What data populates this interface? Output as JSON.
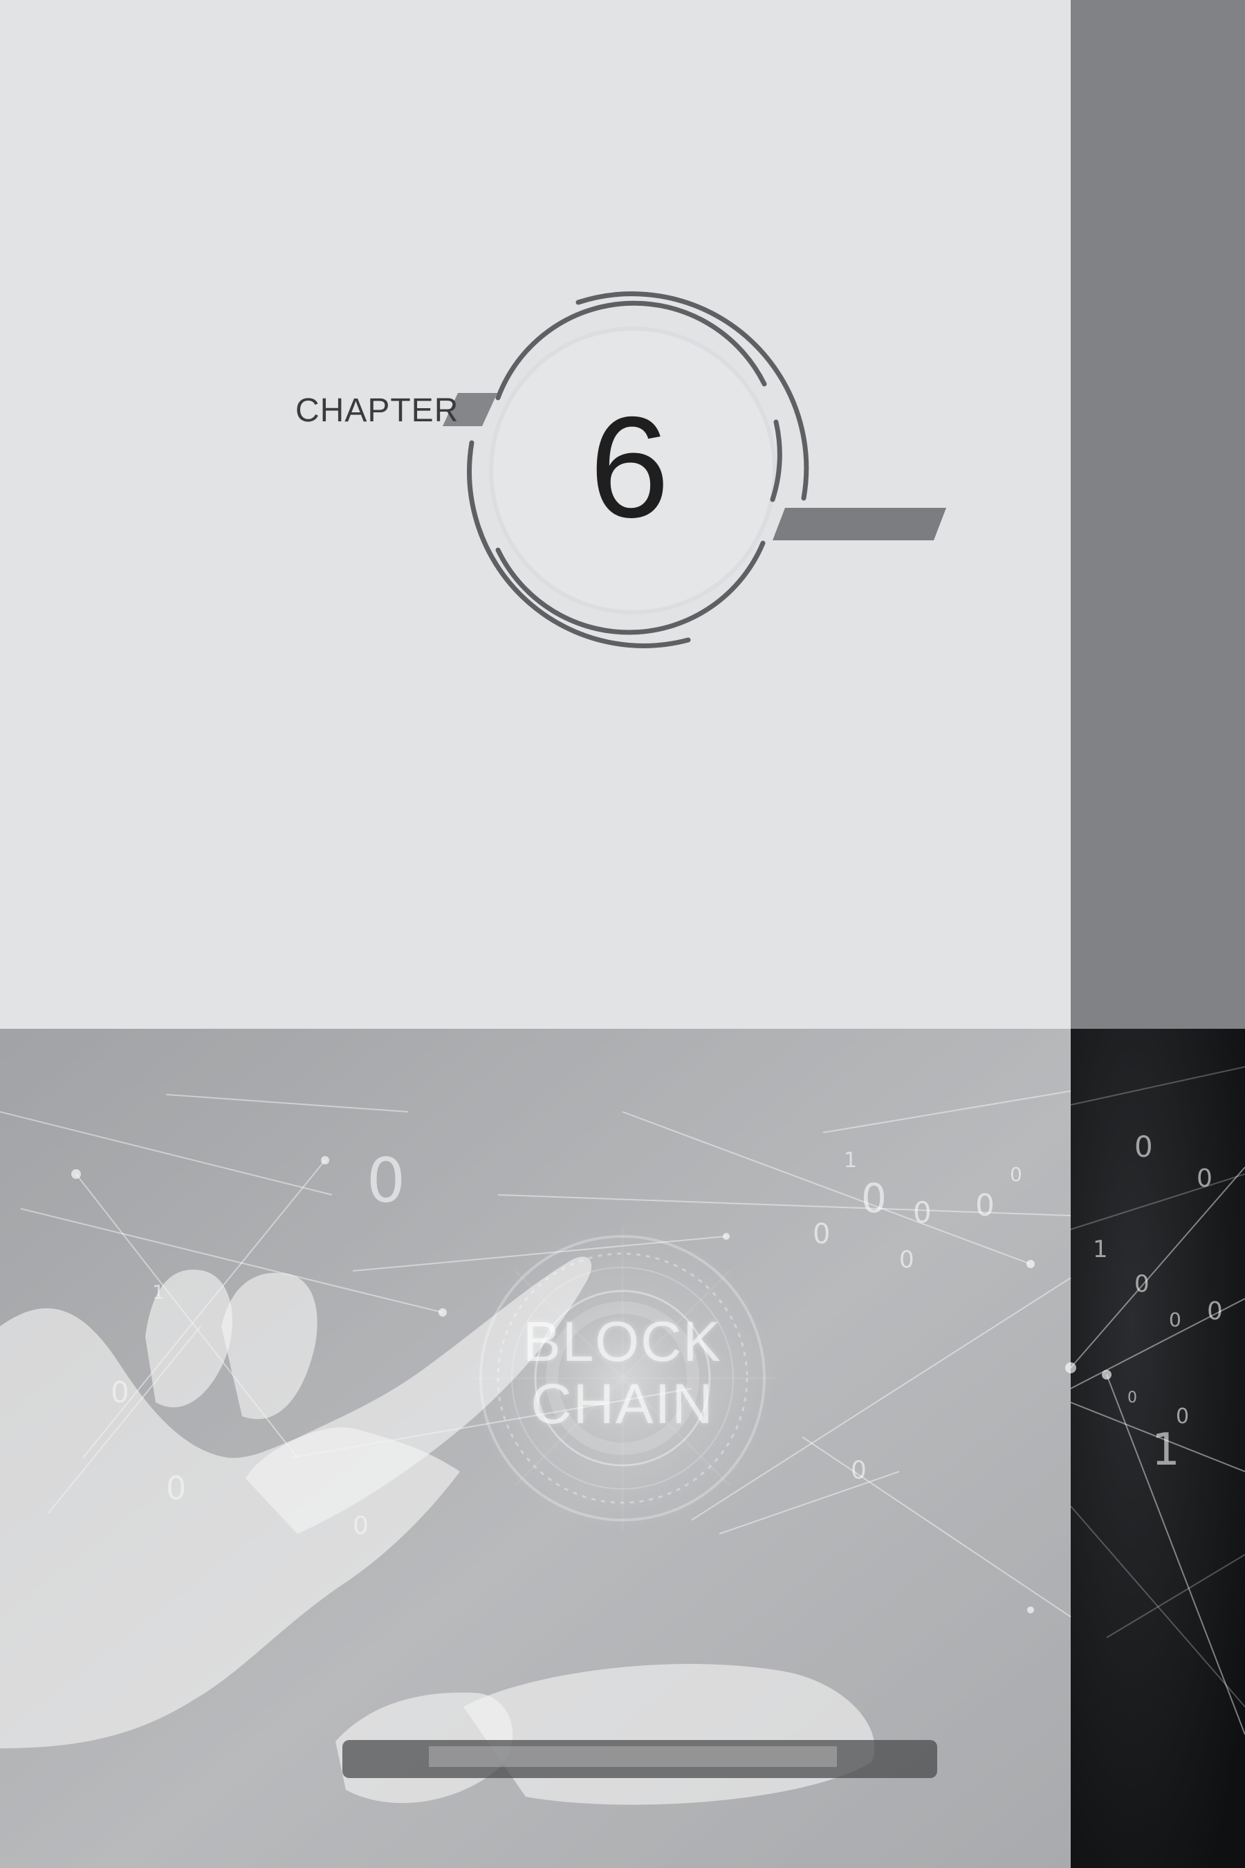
{
  "chapter": {
    "label": "CHAPTER",
    "number": "6"
  },
  "hero": {
    "title": "BLOCK\nCHAIN"
  },
  "colors": {
    "page_background": "#e2e3e5",
    "side_band": "#808286",
    "ring": "#5f6063",
    "accent_bar": "#7e7f82",
    "dark_panel": "#18191b"
  },
  "icons": [
    "network-pattern",
    "binary-digits",
    "hand-touch",
    "glowing-circle"
  ]
}
